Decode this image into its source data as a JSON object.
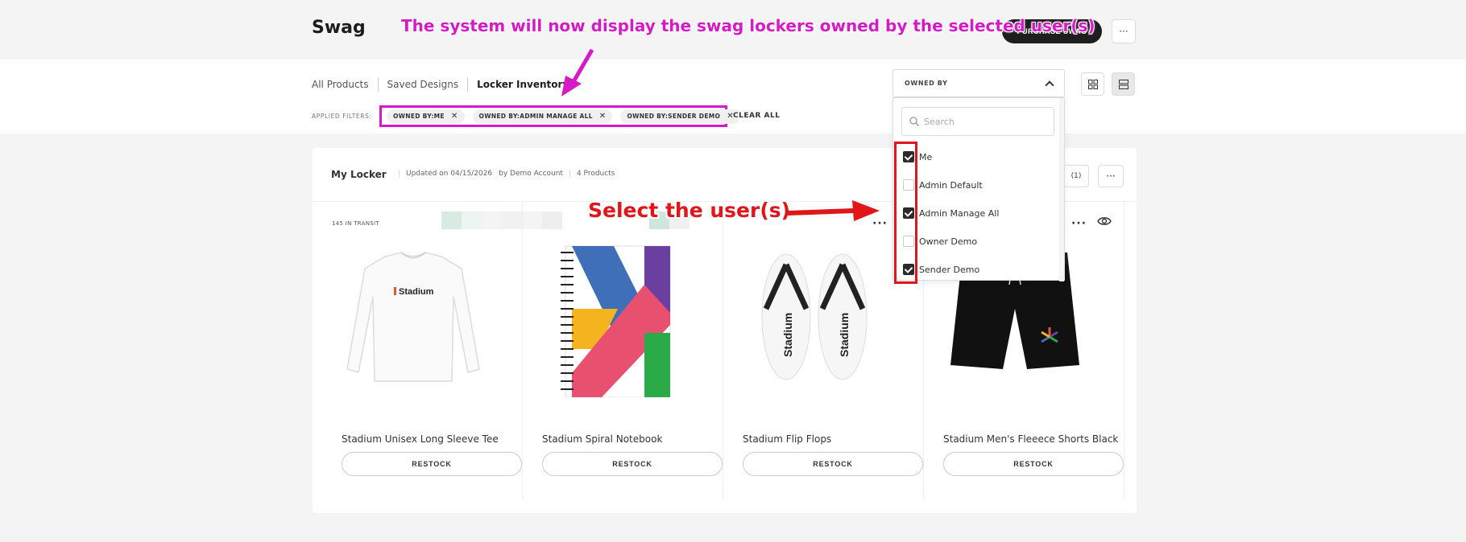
{
  "header": {
    "title": "Swag",
    "purchase_label": "PURCHASE SWAG",
    "more": "···"
  },
  "tabs": [
    {
      "label": "All Products"
    },
    {
      "label": "Saved Designs"
    },
    {
      "label": "Locker Inventory"
    }
  ],
  "filters": {
    "label": "APPLIED FILTERS:",
    "chips": [
      {
        "label": "OWNED BY:ME"
      },
      {
        "label": "OWNED BY:ADMIN MANAGE ALL"
      },
      {
        "label": "OWNED BY:SENDER DEMO"
      }
    ],
    "clear_all": "CLEAR ALL"
  },
  "owned_by": {
    "label": "OWNED BY",
    "search_placeholder": "Search",
    "options": [
      {
        "label": "Me",
        "checked": true
      },
      {
        "label": "Admin Default",
        "checked": false
      },
      {
        "label": "Admin Manage All",
        "checked": true
      },
      {
        "label": "Owner Demo",
        "checked": false
      },
      {
        "label": "Sender Demo",
        "checked": true
      }
    ]
  },
  "locker": {
    "name": "My Locker",
    "updated": "Updated on 04/15/2026",
    "by": "by Demo Account",
    "count": "4 Products",
    "count_btn": "(1)",
    "more": "···",
    "transit": "145 IN TRANSIT",
    "card_more": "···"
  },
  "products": [
    {
      "name": "Stadium Unisex Long Sleeve Tee",
      "restock": "RESTOCK"
    },
    {
      "name": "Stadium Spiral Notebook",
      "restock": "RESTOCK"
    },
    {
      "name": "Stadium Flip Flops",
      "restock": "RESTOCK"
    },
    {
      "name": "Stadium Men's Fleeece Shorts Black",
      "restock": "RESTOCK"
    }
  ],
  "annotations": {
    "top": "The system will now display the swag lockers owned by the selected user(s)",
    "select": "Select the user(s)"
  },
  "colors": {
    "magenta": "#d61ac8",
    "red": "#e0161b",
    "dark": "#1e1e1e"
  }
}
